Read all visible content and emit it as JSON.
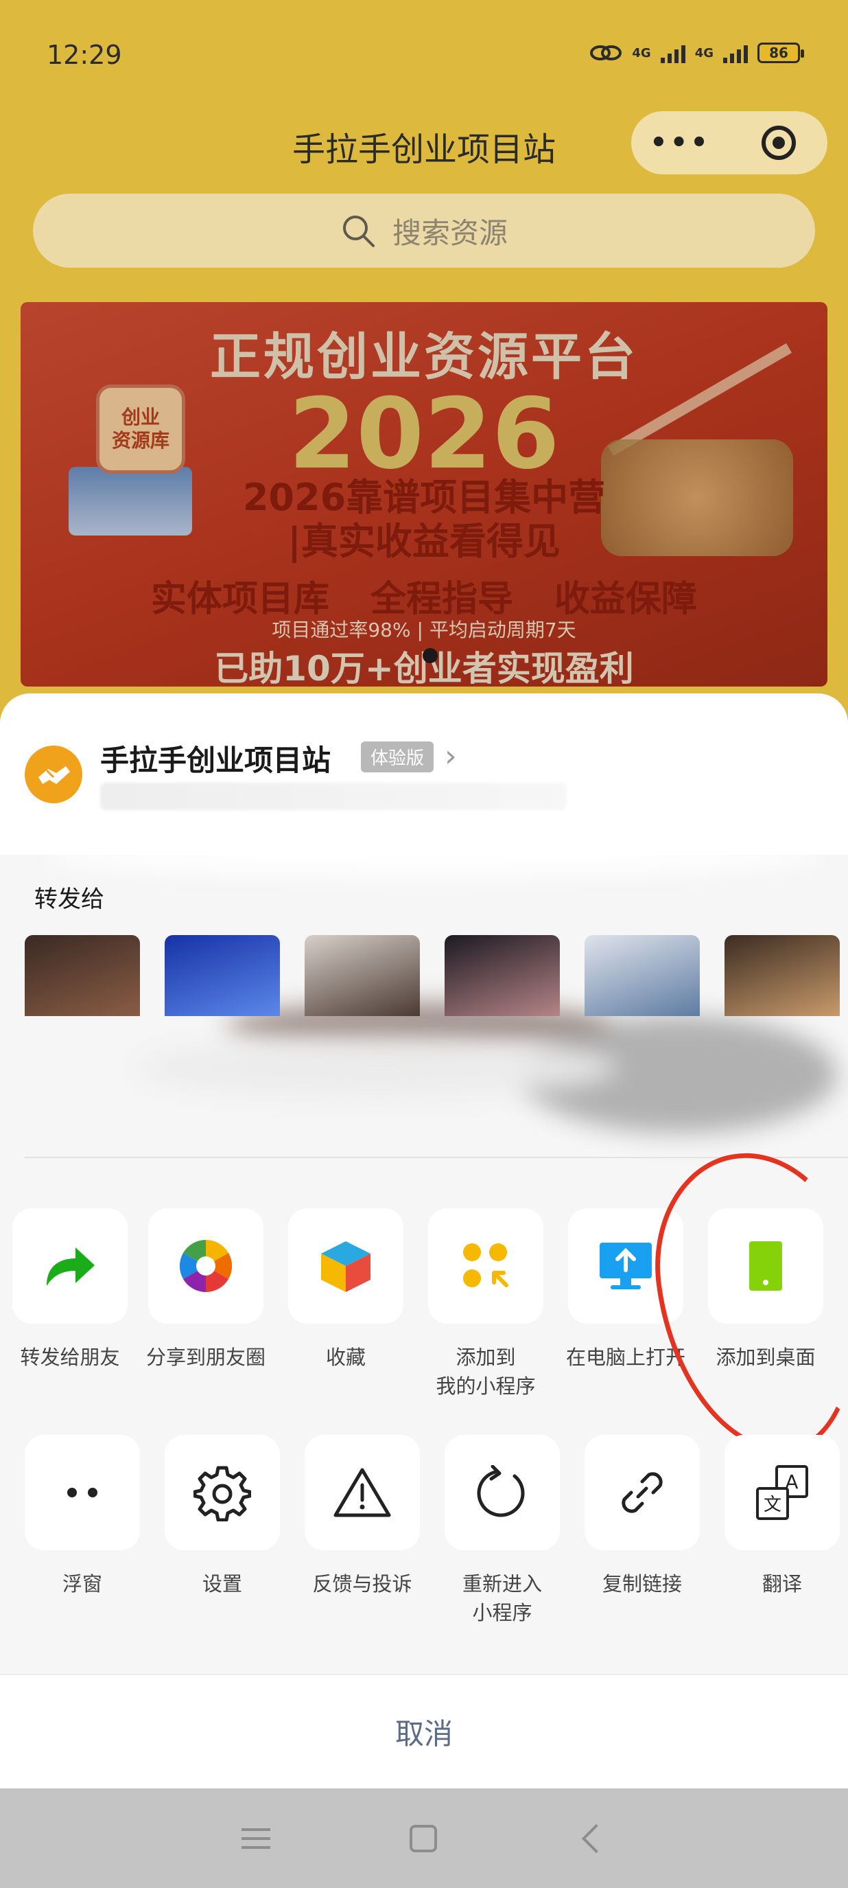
{
  "status_bar": {
    "time": "12:29",
    "network_1": "4G",
    "network_2": "4G",
    "battery": "86"
  },
  "app": {
    "title": "手拉手创业项目站",
    "capsule_more_icon": "more-dots-icon",
    "capsule_close_icon": "target-close-icon",
    "search_placeholder": "搜索资源"
  },
  "banner": {
    "title": "正规创业资源平台",
    "year": "2026",
    "line1": "2026靠谱项目集中营",
    "line2": "|真实收益看得见",
    "features": [
      "实体项目库",
      "全程指导",
      "收益保障"
    ],
    "stats": "项目通过率98% | 平均启动周期7天",
    "footer": "已助10万+创业者实现盈利",
    "book_label": "创业\n资源库"
  },
  "sheet": {
    "mini_program_name": "手拉手创业项目站",
    "badge": "体验版",
    "forward_label": "转发给",
    "contacts": [
      {
        "colors": [
          "#3a2a24",
          "#8a5d44"
        ]
      },
      {
        "colors": [
          "#1632a6",
          "#5c88e8"
        ]
      },
      {
        "colors": [
          "#d6cfc8",
          "#4b3a33"
        ]
      },
      {
        "colors": [
          "#1c1a22",
          "#b58486"
        ]
      },
      {
        "colors": [
          "#dfe3ea",
          "#5e7ca3"
        ]
      },
      {
        "colors": [
          "#3b2c22",
          "#c89a6a"
        ]
      }
    ],
    "actions_row1": [
      {
        "label": "转发给朋友",
        "icon": "forward-arrow-icon"
      },
      {
        "label": "分享到朋友圈",
        "icon": "moments-aperture-icon"
      },
      {
        "label": "收藏",
        "icon": "favorite-cube-icon"
      },
      {
        "label": "添加到\n我的小程序",
        "icon": "my-miniprogram-icon"
      },
      {
        "label": "在电脑上打开",
        "icon": "computer-open-icon"
      },
      {
        "label": "添加到桌面",
        "icon": "add-to-desktop-icon"
      }
    ],
    "actions_row2": [
      {
        "label": "浮窗",
        "icon": "float-window-icon"
      },
      {
        "label": "设置",
        "icon": "settings-gear-icon"
      },
      {
        "label": "反馈与投诉",
        "icon": "warning-triangle-icon"
      },
      {
        "label": "重新进入\n小程序",
        "icon": "reload-icon"
      },
      {
        "label": "复制链接",
        "icon": "link-icon"
      },
      {
        "label": "翻译",
        "icon": "translate-icon"
      }
    ],
    "cancel": "取消"
  },
  "colors": {
    "brand_yellow": "#ddb93e",
    "annotation_red": "#e43420",
    "cancel_text": "#5a6b8c",
    "wechat_green": "#1aad19"
  }
}
